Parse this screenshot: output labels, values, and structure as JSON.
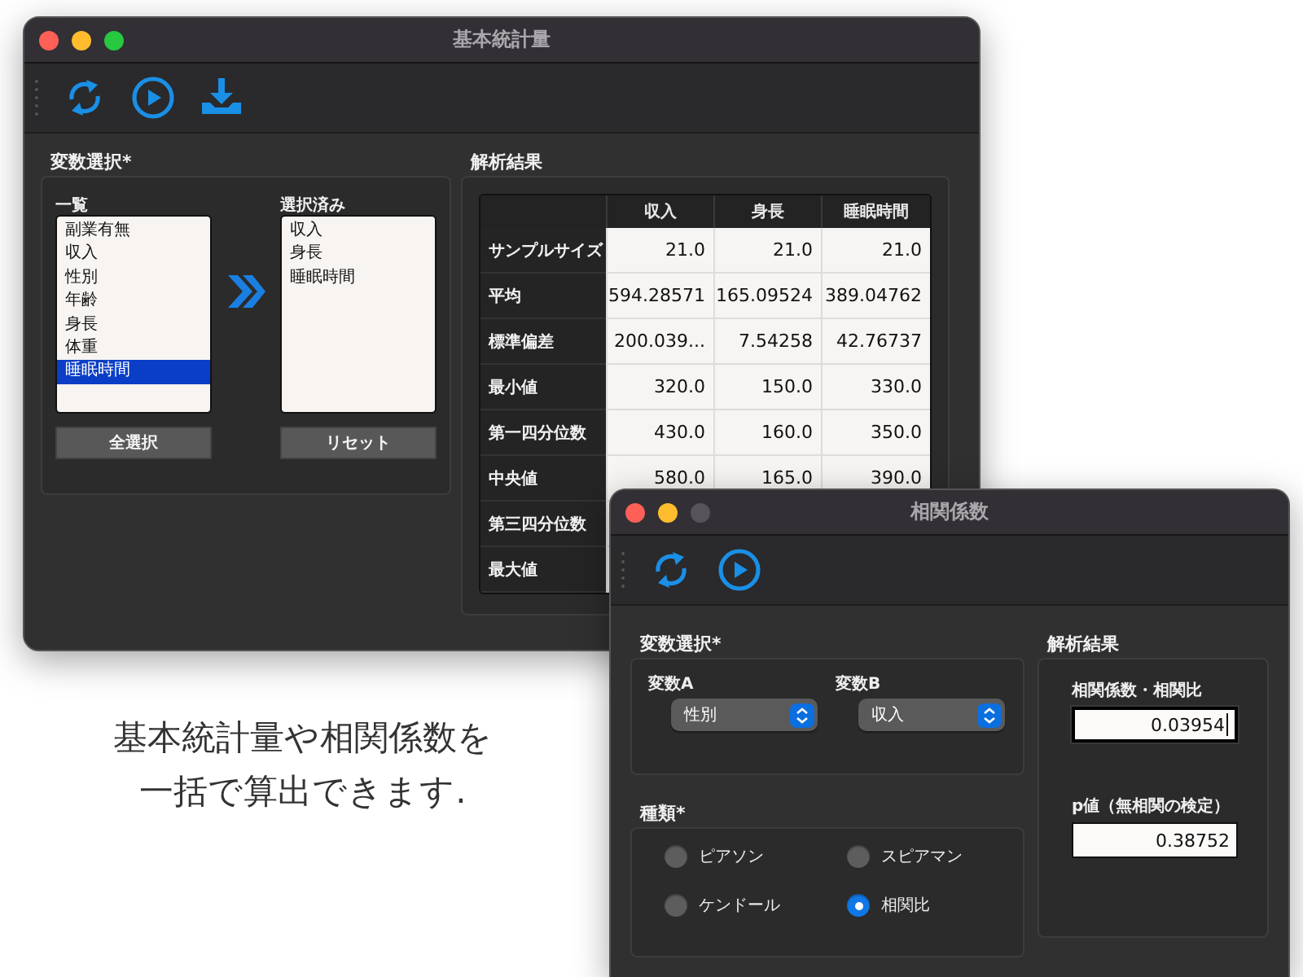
{
  "stats_window": {
    "title": "基本統計量",
    "zoom_disabled": false,
    "toolbar": [
      {
        "kind": "refresh"
      },
      {
        "kind": "run"
      },
      {
        "kind": "export"
      }
    ],
    "variable_selection": {
      "heading": "変数選択*",
      "available": {
        "heading": "一覧",
        "items": [
          {
            "label": "副業有無",
            "selected": false
          },
          {
            "label": "収入",
            "selected": false
          },
          {
            "label": "性別",
            "selected": false
          },
          {
            "label": "年齢",
            "selected": false
          },
          {
            "label": "身長",
            "selected": false
          },
          {
            "label": "体重",
            "selected": false
          },
          {
            "label": "睡眠時間",
            "selected": true
          }
        ]
      },
      "chosen": {
        "heading": "選択済み",
        "items": [
          "収入",
          "身長",
          "睡眠時間"
        ]
      },
      "buttons": [
        "全選択",
        "リセット"
      ]
    },
    "results": {
      "heading": "解析結果",
      "table": {
        "columns": [
          "収入",
          "身長",
          "睡眠時間"
        ],
        "rows": [
          {
            "label": "サンプルサイズ",
            "values": [
              "21.0",
              "21.0",
              "21.0"
            ]
          },
          {
            "label": "平均",
            "values": [
              "594.28571",
              "165.09524",
              "389.04762"
            ]
          },
          {
            "label": "標準偏差",
            "values": [
              "200.039...",
              "7.54258",
              "42.76737"
            ]
          },
          {
            "label": "最小値",
            "values": [
              "320.0",
              "150.0",
              "330.0"
            ]
          },
          {
            "label": "第一四分位数",
            "values": [
              "430.0",
              "160.0",
              "350.0"
            ]
          },
          {
            "label": "中央値",
            "values": [
              "580.0",
              "165.0",
              "390.0"
            ]
          },
          {
            "label": "第三四分位数"
          },
          {
            "label": "最大値"
          }
        ]
      }
    }
  },
  "correlation_window": {
    "title": "相関係数",
    "zoom_disabled": true,
    "toolbar": [
      {
        "kind": "refresh"
      },
      {
        "kind": "run"
      }
    ],
    "variable_selection": {
      "heading": "変数選択*",
      "variable_a": {
        "label": "変数A",
        "value": "性別"
      },
      "variable_b": {
        "label": "変数B",
        "value": "収入"
      }
    },
    "type": {
      "heading": "種類*",
      "options": [
        {
          "label": "ピアソン",
          "selected": false
        },
        {
          "label": "スピアマン",
          "selected": false
        },
        {
          "label": "ケンドール",
          "selected": false
        },
        {
          "label": "相関比",
          "selected": true
        }
      ]
    },
    "results": {
      "heading": "解析結果",
      "fields": [
        {
          "label": "相関係数・相関比",
          "value": "0.03954",
          "focused": true
        },
        {
          "label": "p値（無相関の検定）",
          "value": "0.38752",
          "focused": false
        }
      ]
    }
  },
  "caption": [
    "基本統計量や相関係数を",
    "一括で算出できます."
  ]
}
